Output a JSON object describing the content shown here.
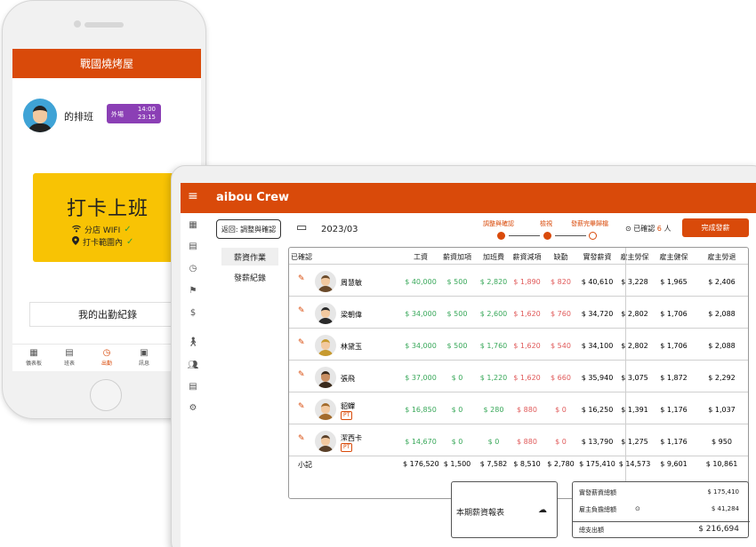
{
  "phone": {
    "header_title": "戰國燒烤屋",
    "schedule_title": "的排班",
    "shift": {
      "tag": "外場",
      "start": "14:00",
      "end": "23:15"
    },
    "punch_label": "打卡上班",
    "wifi_label": "分店 WIFI",
    "range_label": "打卡範圍內",
    "records_label": "我的出勤紀錄",
    "tabs": [
      {
        "label": "儀表板",
        "icon": "dashboard-icon"
      },
      {
        "label": "班表",
        "icon": "calendar-icon"
      },
      {
        "label": "出勤",
        "icon": "clock-icon",
        "active": true
      },
      {
        "label": "訊息",
        "icon": "message-icon"
      }
    ],
    "accent_color": "#d94a0a"
  },
  "tablet": {
    "brand_a": "aibou",
    "brand_b": "Crew",
    "back_button": "返回: 調整與確認",
    "month": "2023/03",
    "steps": [
      "調整與確認",
      "檢視",
      "發薪完畢歸檔"
    ],
    "confirmed_prefix": "已確認",
    "confirmed_count": "6",
    "confirmed_suffix": "人",
    "done_button": "完成發薪",
    "subnav": [
      "薪資作業",
      "發薪紀錄"
    ],
    "table": {
      "headers": [
        "已確認",
        "工資",
        "薪資加項",
        "加班費",
        "薪資減項",
        "缺勤",
        "實發薪資",
        "雇主勞保",
        "雇主健保",
        "雇主勞退"
      ],
      "rows": [
        {
          "name": "周慧敏",
          "pt": "",
          "cells": [
            "$ 40,000",
            "$ 500",
            "$ 2,820",
            "$ 1,890",
            "$ 820",
            "$ 40,610",
            "$ 3,228",
            "$ 1,965",
            "$ 2,406"
          ]
        },
        {
          "name": "梁朝偉",
          "pt": "",
          "cells": [
            "$ 34,000",
            "$ 500",
            "$ 2,600",
            "$ 1,620",
            "$ 760",
            "$ 34,720",
            "$ 2,802",
            "$ 1,706",
            "$ 2,088"
          ]
        },
        {
          "name": "林黛玉",
          "pt": "",
          "cells": [
            "$ 34,000",
            "$ 500",
            "$ 1,760",
            "$ 1,620",
            "$ 540",
            "$ 34,100",
            "$ 2,802",
            "$ 1,706",
            "$ 2,088"
          ]
        },
        {
          "name": "張飛",
          "pt": "",
          "cells": [
            "$ 37,000",
            "$ 0",
            "$ 1,220",
            "$ 1,620",
            "$ 660",
            "$ 35,940",
            "$ 3,075",
            "$ 1,872",
            "$ 2,292"
          ]
        },
        {
          "name": "貂蟬",
          "pt": "PT",
          "cells": [
            "$ 16,850",
            "$ 0",
            "$ 280",
            "$ 880",
            "$ 0",
            "$ 16,250",
            "$ 1,391",
            "$ 1,176",
            "$ 1,037"
          ]
        },
        {
          "name": "潔西卡",
          "pt": "PT",
          "cells": [
            "$ 14,670",
            "$ 0",
            "$ 0",
            "$ 880",
            "$ 0",
            "$ 13,790",
            "$ 1,275",
            "$ 1,176",
            "$ 950"
          ]
        }
      ],
      "subtotal_label": "小記",
      "subtotal": [
        "$ 176,520",
        "$ 1,500",
        "$ 7,582",
        "$ 8,510",
        "$ 2,780",
        "$ 175,410",
        "$ 14,573",
        "$ 9,601",
        "$ 10,861"
      ]
    },
    "report_label": "本期薪資報表",
    "summary": {
      "net_pay_label": "實發薪資總額",
      "net_pay": "$ 175,410",
      "employer_label": "雇主負擔總額",
      "employer": "$ 41,284",
      "total_label": "總支出額",
      "total": "$ 216,694"
    }
  }
}
